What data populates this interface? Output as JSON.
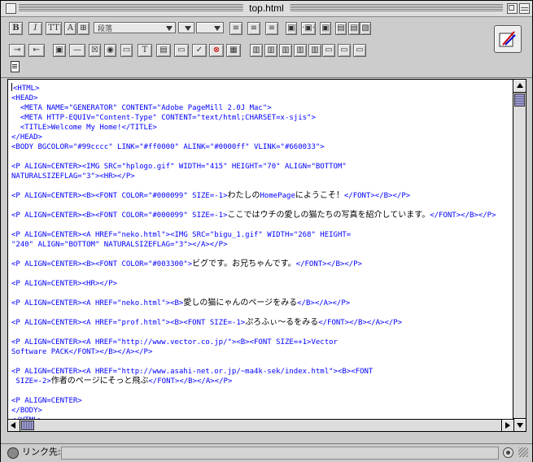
{
  "window": {
    "title": "top.html"
  },
  "toolbar": {
    "row1": {
      "bold": "B",
      "italic": "I",
      "teletype": "TT",
      "paragraph_format": "段落"
    }
  },
  "editor": {
    "lines": [
      "<HTML>",
      "<HEAD>",
      "  <META NAME=\"GENERATOR\" CONTENT=\"Adobe PageMill 2.0J Mac\">",
      "  <META HTTP-EQUIV=\"Content-Type\" CONTENT=\"text/html;CHARSET=x-sjis\">",
      "  <TITLE>Welcome My Home!</TITLE>",
      "</HEAD>",
      "<BODY BGCOLOR=\"#99cccc\" LINK=\"#ff0000\" ALINK=\"#0000ff\" VLINK=\"#660033\">",
      "",
      "<P ALIGN=CENTER><IMG SRC=\"hplogo.gif\" WIDTH=\"415\" HEIGHT=\"70\" ALIGN=\"BOTTOM\"",
      "NATURALSIZEFLAG=\"3\"><HR></P>",
      "",
      "<P ALIGN=CENTER><B><FONT COLOR=\"#000099\" SIZE=-1>わたしのHomePageにようこそ！</FONT></B></P>",
      "",
      "<P ALIGN=CENTER><B><FONT COLOR=\"#000099\" SIZE=-1>ここではウチの愛しの猫たちの写真を紹介しています。</FONT></B></P>",
      "",
      "<P ALIGN=CENTER><A HREF=\"neko.html\"><IMG SRC=\"bigu_1.gif\" WIDTH=\"268\" HEIGHT=",
      "\"240\" ALIGN=\"BOTTOM\" NATURALSIZEFLAG=\"3\"></A></P>",
      "",
      "<P ALIGN=CENTER><B><FONT COLOR=\"#003300\">ビグです。お兄ちゃんです。</FONT></B></P>",
      "",
      "<P ALIGN=CENTER><HR></P>",
      "",
      "<P ALIGN=CENTER><A HREF=\"neko.html\"><B>愛しの猫にゃんのページをみる</B></A></P>",
      "",
      "<P ALIGN=CENTER><A HREF=\"prof.html\"><B><FONT SIZE=-1>ぷろふぃ～るをみる</FONT></B></A></P>",
      "",
      "<P ALIGN=CENTER><A HREF=\"http://www.vector.co.jp/\"><B><FONT SIZE=+1>Vector",
      "Software PACK</FONT></B></A></P>",
      "",
      "<P ALIGN=CENTER><A HREF=\"http://www.asahi-net.or.jp/~ma4k-sek/index.html\"><B><FONT",
      " SIZE=-2>作者のページにそっと飛ぶ</FONT></B></A></P>",
      "",
      "<P ALIGN=CENTER>",
      "</BODY>",
      "</HTML>"
    ]
  },
  "status": {
    "link_label": "リンク先:",
    "link_value": ""
  },
  "colors": {
    "code_tag": "#0000ff",
    "code_text": "#000000",
    "background": "#cccccc",
    "scroll_thumb": "#9999cc"
  }
}
